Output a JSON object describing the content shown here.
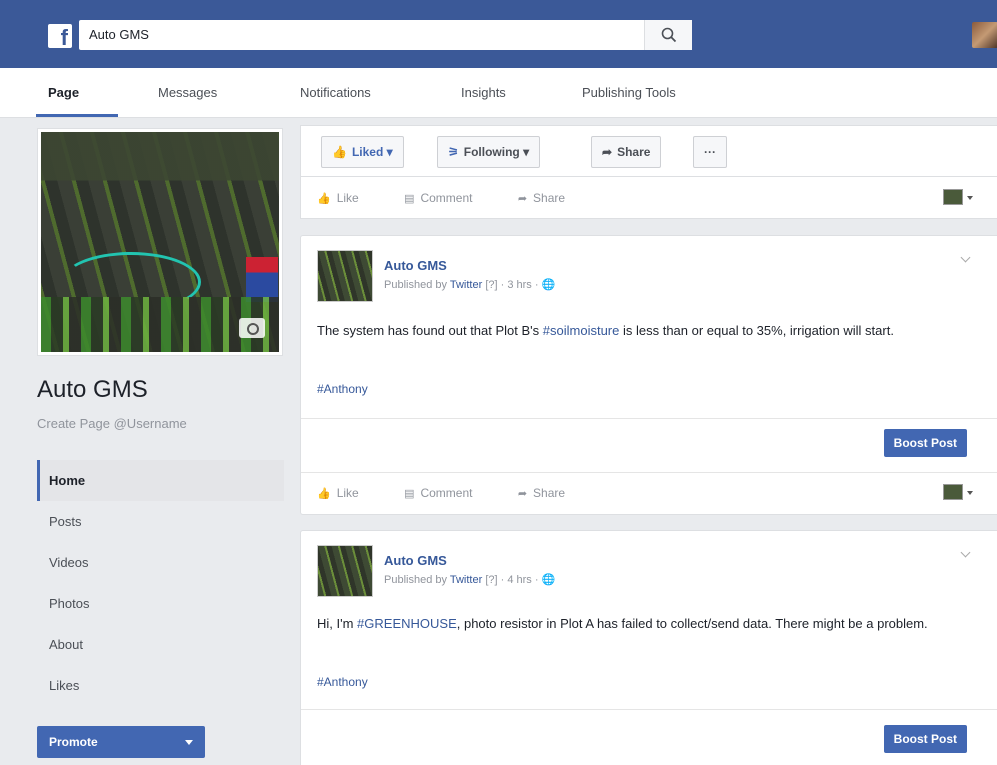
{
  "topbar": {
    "search_value": "Auto GMS",
    "logo_icon": "facebook-logo",
    "brand_color": "#3b5998"
  },
  "tabs": [
    {
      "label": "Page",
      "active": true
    },
    {
      "label": "Messages"
    },
    {
      "label": "Notifications"
    },
    {
      "label": "Insights"
    },
    {
      "label": "Publishing Tools"
    }
  ],
  "profile": {
    "name": "Auto GMS",
    "handle": "Create Page @Username"
  },
  "sidebar": {
    "items": [
      {
        "label": "Home",
        "active": true
      },
      {
        "label": "Posts"
      },
      {
        "label": "Videos"
      },
      {
        "label": "Photos"
      },
      {
        "label": "About"
      },
      {
        "label": "Likes"
      }
    ],
    "promote_label": "Promote"
  },
  "actions": {
    "liked": "Liked ▾",
    "following": "Following ▾",
    "share": "Share",
    "more": "···"
  },
  "ufi": {
    "like": "Like",
    "comment": "Comment",
    "share": "Share"
  },
  "posts": [
    {
      "author": "Auto GMS",
      "meta_prefix": "Published by",
      "meta_source": "Twitter",
      "meta_suffix": "[?] · 3 hrs ·",
      "text_before": "The system has found out that Plot B's ",
      "hashtag": "#soilmoisture",
      "text_after": " is less than or equal to 35%, irrigation will start.",
      "tag": "#Anthony",
      "boost_label": "Boost Post"
    },
    {
      "author": "Auto GMS",
      "meta_prefix": "Published by",
      "meta_source": "Twitter",
      "meta_suffix": "[?] · 4 hrs ·",
      "text_before": "Hi, I'm ",
      "hashtag": "#GREENHOUSE",
      "text_after": ", photo resistor in Plot A has failed to collect/send data. There might be a problem.",
      "tag": "#Anthony",
      "boost_label": "Boost Post"
    }
  ],
  "colors": {
    "accent": "#4267b2",
    "link": "#365899",
    "background": "#e9ebee"
  }
}
